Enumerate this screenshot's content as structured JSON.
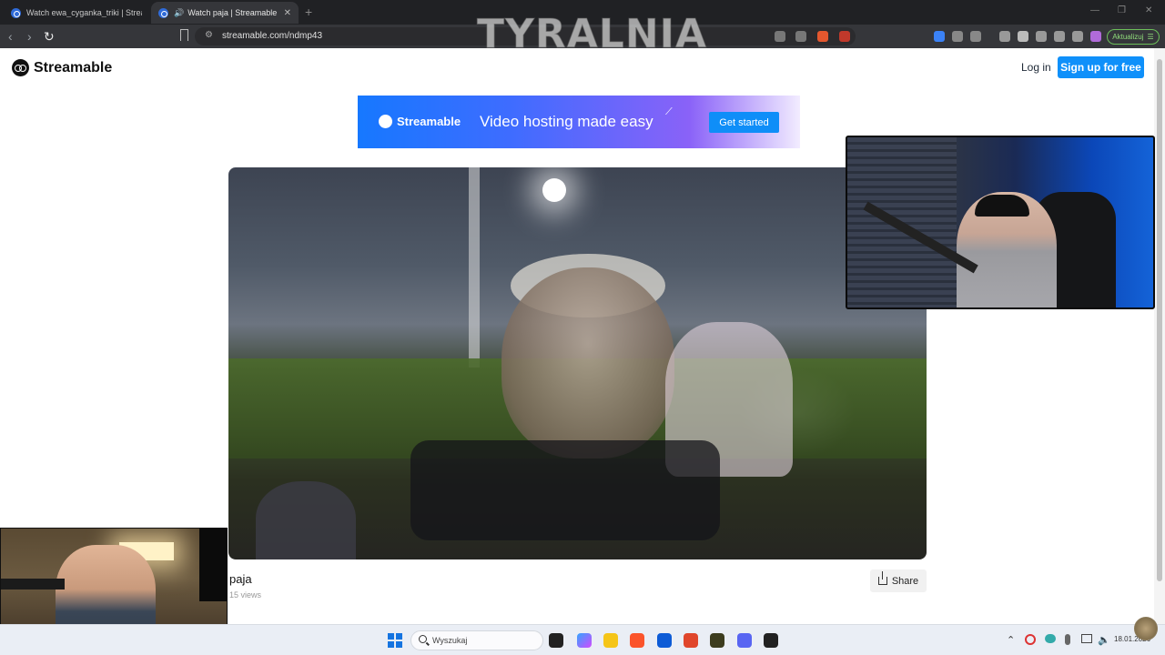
{
  "browser": {
    "tabs": [
      {
        "title": "Watch ewa_cyganka_triki | Streamabl…"
      },
      {
        "title": "Watch paja | Streamable",
        "close": "✕"
      }
    ],
    "new_tab": "+",
    "url": "streamable.com/ndmp43",
    "update_label": "Aktualizuj"
  },
  "overlay": {
    "watermark": "TYRALNIA"
  },
  "site": {
    "logo_text": "Streamable",
    "login": "Log in",
    "signup": "Sign up for free"
  },
  "banner": {
    "brand": "Streamable",
    "tagline": "Video hosting made easy",
    "cta": "Get started"
  },
  "video": {
    "title": "paja",
    "views": "15 views",
    "share": "Share"
  },
  "taskbar": {
    "search_placeholder": "Wyszukaj",
    "date": "18.01.2026"
  },
  "icons": {
    "back": "‹",
    "forward": "›",
    "reload": "↻",
    "tune": "⚙",
    "up_chevron": "⌃",
    "wifi": "◠",
    "volume": "🔈",
    "speaker_tab": "🔊"
  }
}
